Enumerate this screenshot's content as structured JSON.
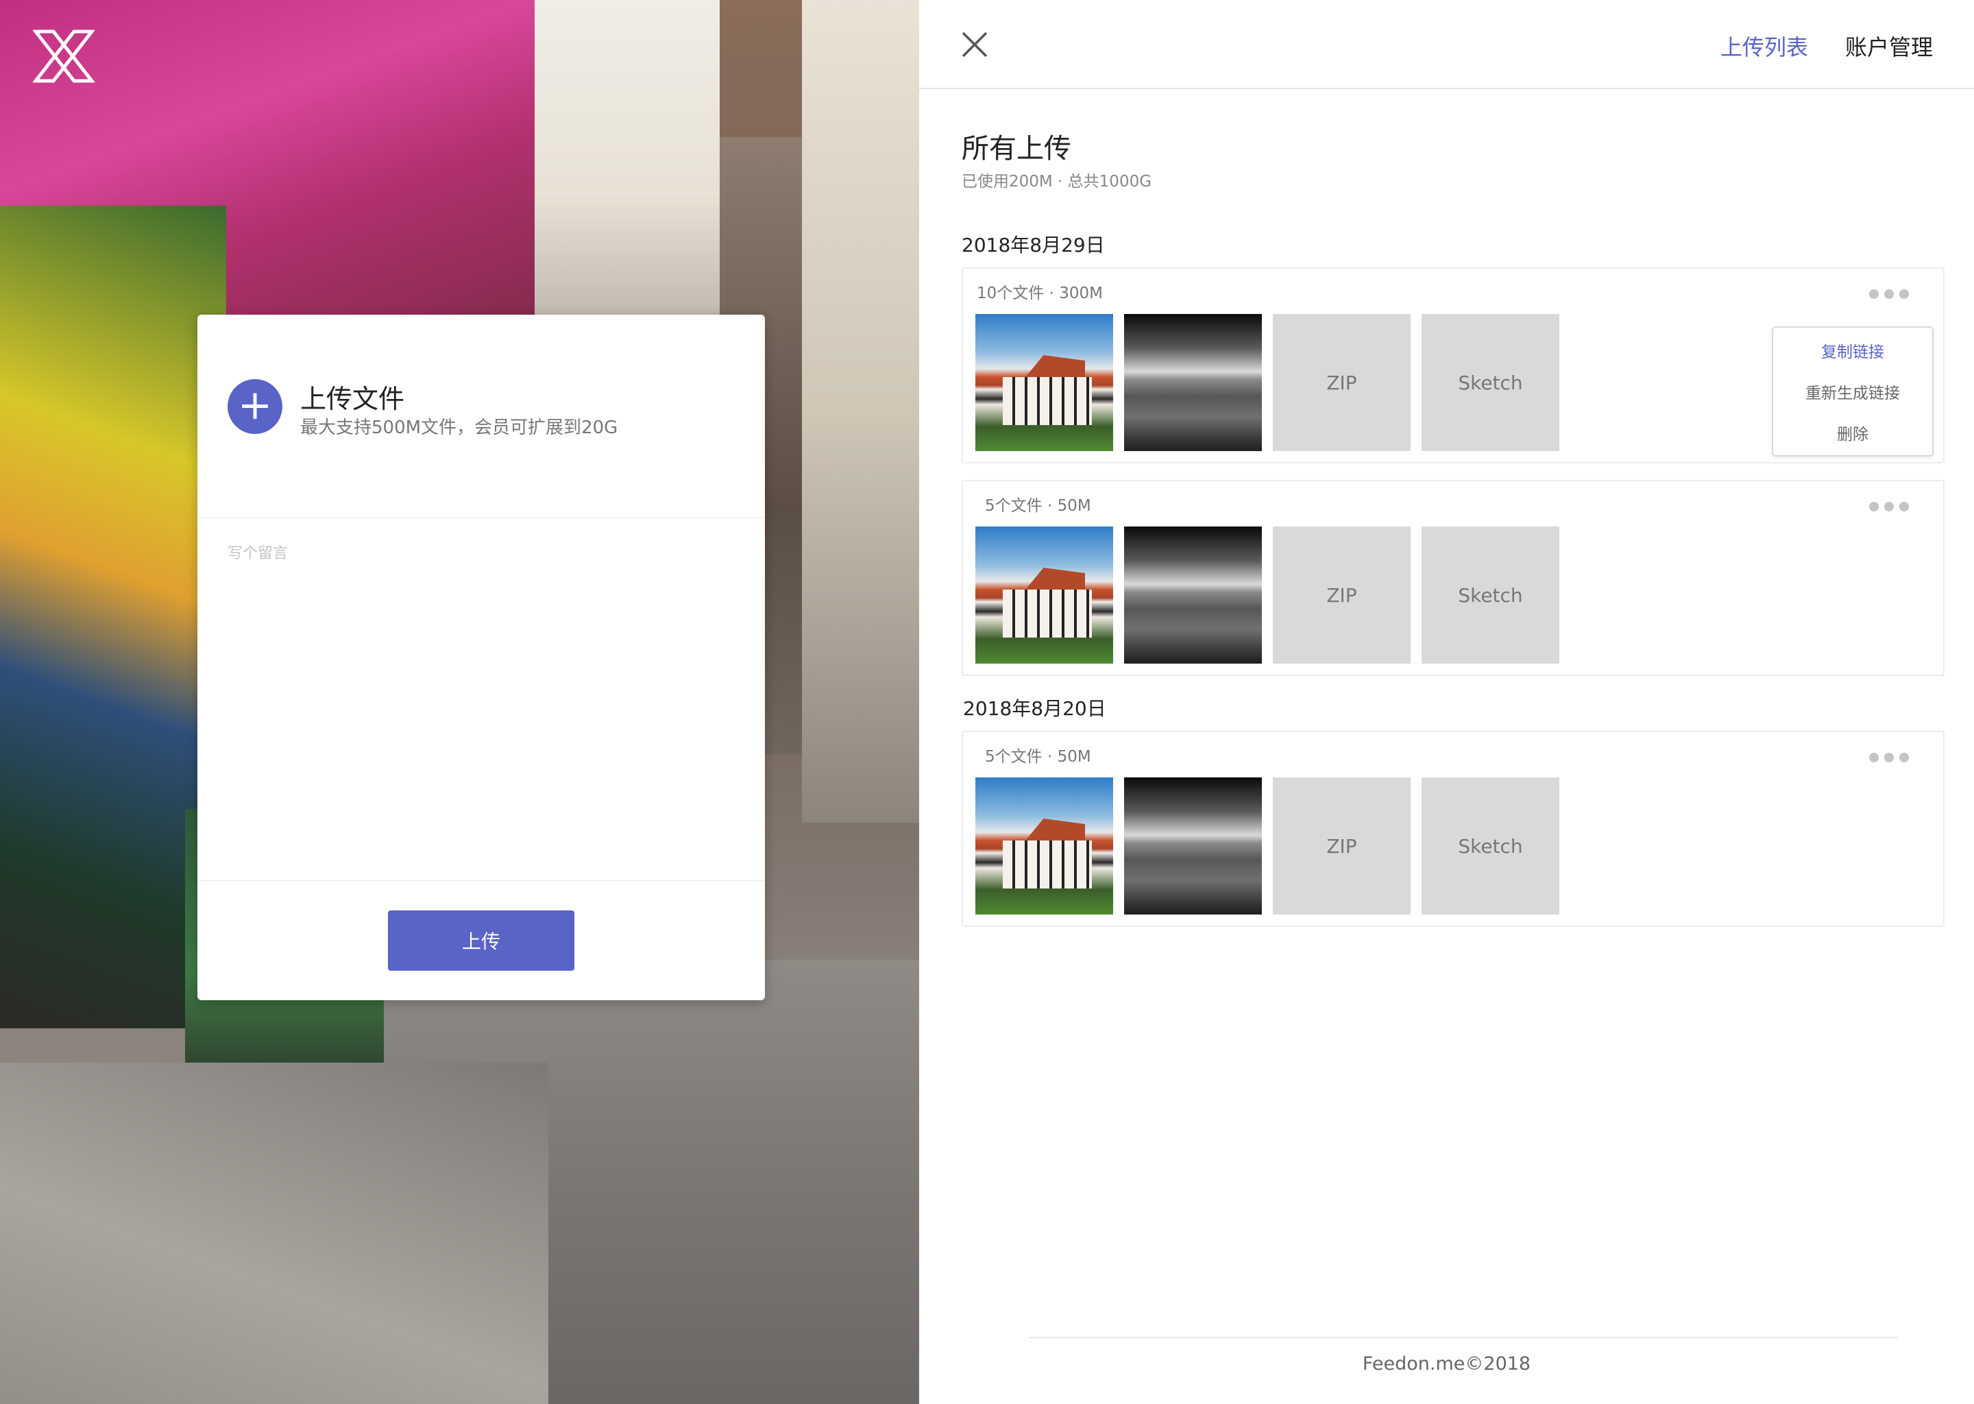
{
  "upload": {
    "title": "上传文件",
    "subtitle": "最大支持500M文件，会员可扩展到20G",
    "add_icon": "plus-icon",
    "message_placeholder": "写个留言",
    "submit_label": "上传"
  },
  "header": {
    "close_icon": "close-icon",
    "nav": [
      {
        "label": "上传列表",
        "active": true
      },
      {
        "label": "账户管理",
        "active": false
      }
    ]
  },
  "main": {
    "title": "所有上传",
    "storage": "已使用200M · 总共1000G",
    "dates": [
      "2018年8月29日",
      "2018年8月20日"
    ],
    "groups": [
      {
        "meta": "10个文件 · 300M",
        "files": [
          "photo-house",
          "photo-canyon",
          "ZIP",
          "Sketch"
        ]
      },
      {
        "meta": "5个文件 · 50M",
        "files": [
          "photo-house",
          "photo-canyon",
          "ZIP",
          "Sketch"
        ]
      },
      {
        "meta": "5个文件 · 50M",
        "files": [
          "photo-house",
          "photo-canyon",
          "ZIP",
          "Sketch"
        ]
      }
    ]
  },
  "context_menu": {
    "items": [
      "复制链接",
      "重新生成链接",
      "删除"
    ]
  },
  "footer": {
    "text": "Feedon.me©2018"
  },
  "colors": {
    "accent": "#5a63c6",
    "muted_text": "#888888",
    "placeholder": "#d9d9d9"
  }
}
